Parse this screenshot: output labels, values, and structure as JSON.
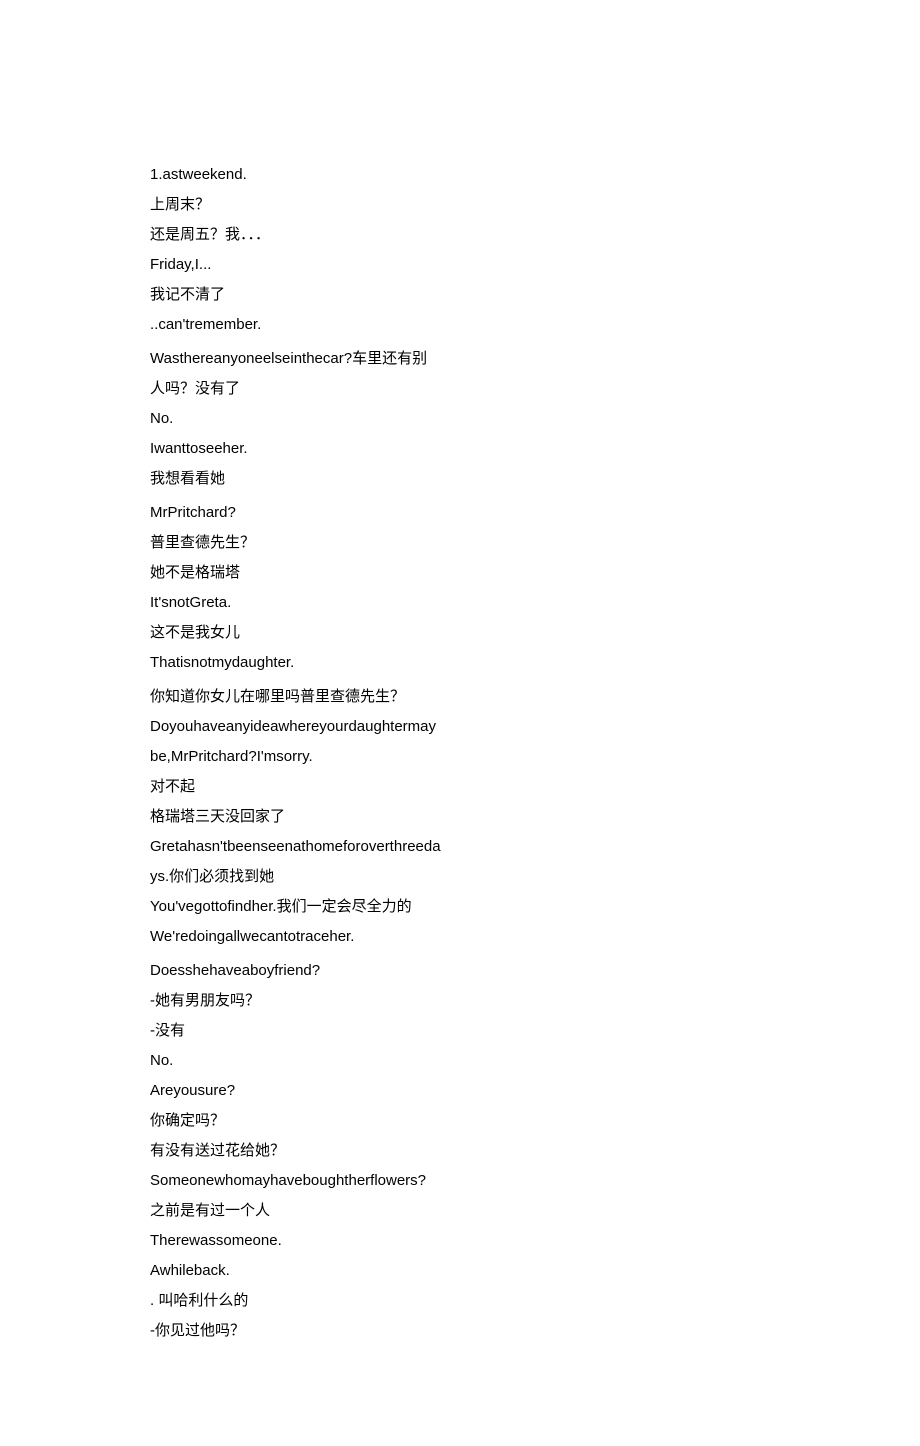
{
  "lines": [
    "1.astweekend.",
    "上周末？",
    "还是周五？我．．．",
    "Friday,I...",
    "我记不清了",
    "..can'tremember.",
    "Wasthereanyoneelseinthecar?车里还有别",
    "人吗？没有了",
    "No.",
    "Iwanttoseeher.",
    "我想看看她",
    "MrPritchard?",
    "普里查德先生？",
    "她不是格瑞塔",
    "It'snotGreta.",
    "这不是我女儿",
    "Thatisnotmydaughter.",
    "你知道你女儿在哪里吗普里查德先生？",
    "Doyouhaveanyideawhereyourdaughtermay",
    "be,MrPritchard?I'msorry.",
    "对不起",
    "格瑞塔三天没回家了",
    "Gretahasn'tbeenseenathomeforoverthreeda",
    "ys.你们必须找到她",
    "You'vegottofindher.我们一定会尽全力的",
    "We'redoingallwecantotraceher.",
    "Doesshehaveaboyfriend?",
    "-她有男朋友吗？",
    "-没有",
    "No.",
    "Areyousure?",
    "你确定吗？",
    "有没有送过花给她？",
    "Someonewhomayhaveboughtherflowers?",
    "之前是有过一个人",
    "Therewassomeone.",
    "Awhileback.",
    ". 叫哈利什么的",
    "-你见过他吗？"
  ],
  "breaks": [
    5,
    10,
    16,
    25
  ]
}
